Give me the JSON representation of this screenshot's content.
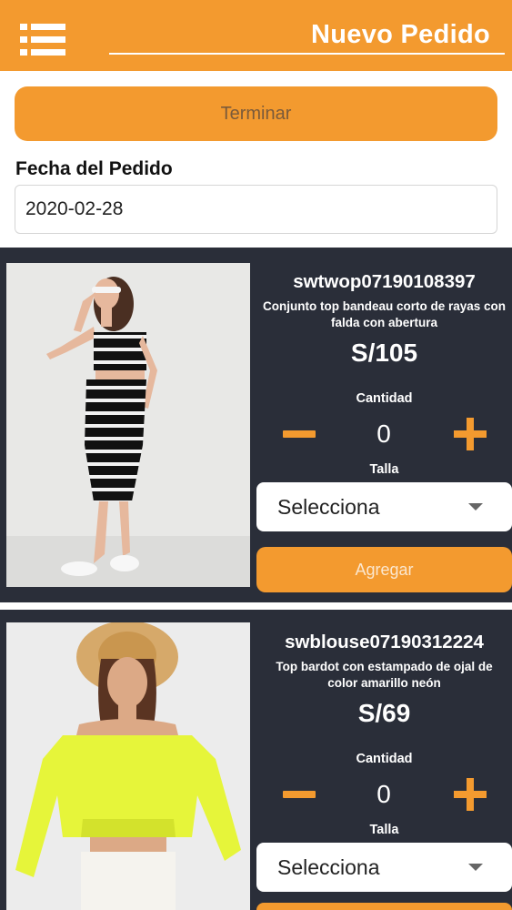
{
  "header": {
    "title": "Nuevo Pedido",
    "menu_icon": "hamburger-list-icon",
    "accent_color": "#f39a2f"
  },
  "actions": {
    "finish_label": "Terminar"
  },
  "order_date": {
    "label": "Fecha del Pedido",
    "value": "2020-02-28"
  },
  "products": [
    {
      "sku": "swtwop07190108397",
      "description": "Conjunto top bandeau corto de rayas con falda con abertura",
      "price": "S/105",
      "quantity_label": "Cantidad",
      "quantity": "0",
      "size_label": "Talla",
      "size_value": "Selecciona",
      "add_label": "Agregar"
    },
    {
      "sku": "swblouse07190312224",
      "description": "Top bardot con estampado de ojal de color amarillo neón",
      "price": "S/69",
      "quantity_label": "Cantidad",
      "quantity": "0",
      "size_label": "Talla",
      "size_value": "Selecciona"
    }
  ],
  "colors": {
    "card_background": "#2a2e39",
    "accent": "#f39a2f"
  }
}
